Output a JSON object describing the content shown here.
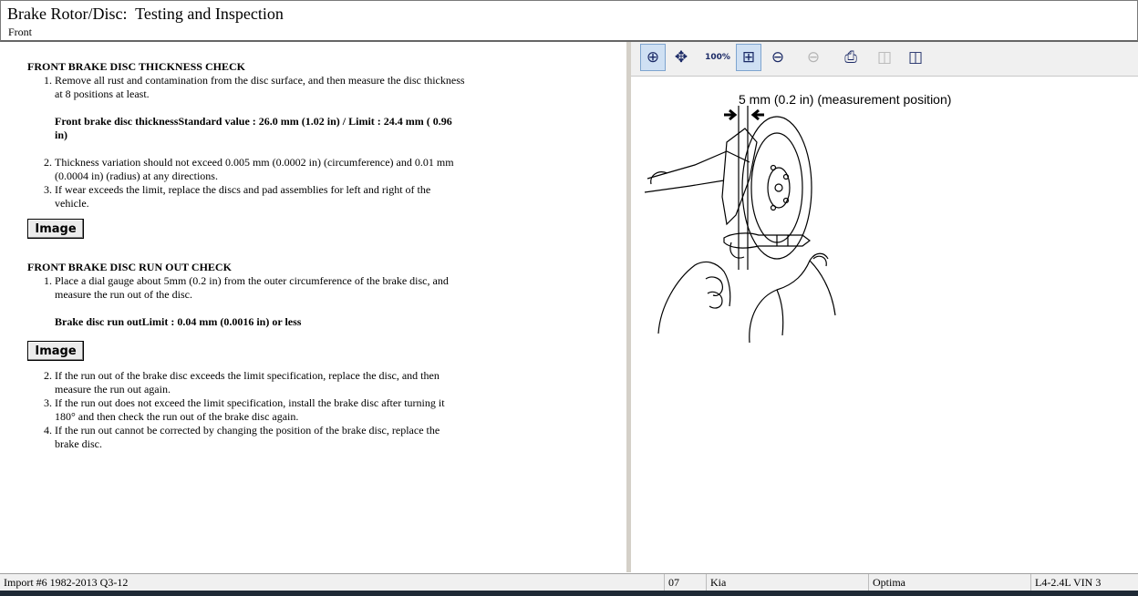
{
  "header": {
    "title": "Brake Rotor/Disc:  Testing and Inspection",
    "subtitle": "Front"
  },
  "sections": [
    {
      "heading": "FRONT BRAKE DISC THICKNESS CHECK",
      "items": [
        "Remove all rust and contamination from the disc surface, and then measure the disc thickness at 8 positions at least."
      ],
      "spec": "Front brake disc thicknessStandard value : 26.0 mm (1.02 in) / Limit : 24.4 mm ( 0.96 in)",
      "items2": [
        "Thickness variation should not exceed 0.005 mm (0.0002 in) (circumference) and 0.01 mm (0.0004 in) (radius) at any directions.",
        "If wear exceeds the limit, replace the discs and pad assemblies for left and right of the vehicle."
      ],
      "image_button": "Image"
    },
    {
      "heading": "FRONT BRAKE DISC RUN OUT CHECK",
      "items": [
        "Place a dial gauge about 5mm (0.2 in) from the outer circumference of the brake disc, and measure the run out of the disc."
      ],
      "spec": "Brake disc run outLimit : 0.04 mm (0.0016 in) or less",
      "image_button": "Image",
      "items2": [
        "If the run out of the brake disc exceeds the limit specification, replace the disc, and then measure the run out again.",
        "If the run out does not exceed the limit specification, install the brake disc after turning it 180° and then check the run out of the brake disc again.",
        "If the run out cannot be corrected by changing the position of the brake disc, replace the brake disc."
      ]
    }
  ],
  "viewer": {
    "figure_label": "5 mm (0.2 in) (measurement position)",
    "zoom_100_label": "100%"
  },
  "status": {
    "source": "Import #6 1982-2013 Q3-12",
    "year": "07",
    "make": "Kia",
    "model": "Optima",
    "engine": "L4-2.4L VIN 3"
  }
}
